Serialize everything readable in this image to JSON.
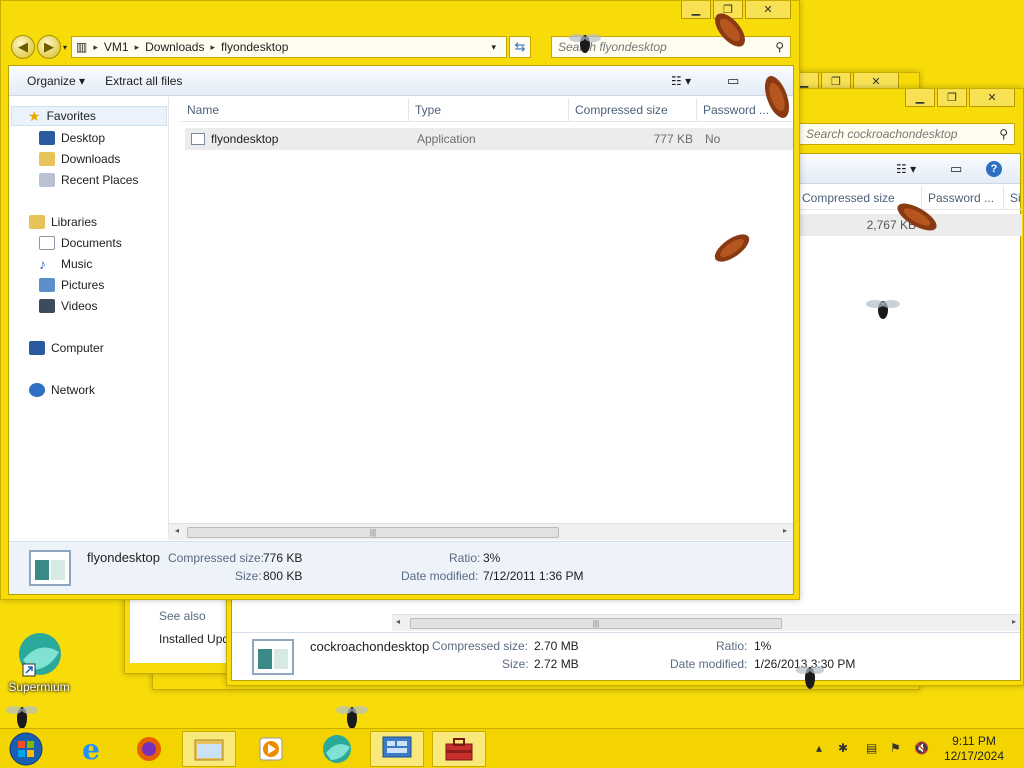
{
  "desktop": {
    "icon_label": "Supermium"
  },
  "back_window": {
    "search_placeholder": "Search cockroachondesktop",
    "columns": [
      "Compressed size",
      "Password ...",
      "Si"
    ],
    "row": {
      "size": "2,767 KB"
    },
    "side_labels": {
      "see_also": "See also",
      "installed": "Installed Upd"
    },
    "details": {
      "name": "cockroachondesktop",
      "compressed_label": "Compressed size:",
      "compressed_value": "2.70 MB",
      "size_label": "Size:",
      "size_value": "2.72 MB",
      "ratio_label": "Ratio:",
      "ratio_value": "1%",
      "modified_label": "Date modified:",
      "modified_value": "1/26/2013 3:30 PM"
    }
  },
  "front_window": {
    "breadcrumb": [
      "VM1",
      "Downloads",
      "flyondesktop"
    ],
    "search_placeholder": "Search flyondesktop",
    "toolbar": {
      "organize": "Organize ▾",
      "extract": "Extract all files"
    },
    "nav": {
      "favorites": "Favorites",
      "desktop": "Desktop",
      "downloads": "Downloads",
      "recent": "Recent Places",
      "libraries": "Libraries",
      "documents": "Documents",
      "music": "Music",
      "pictures": "Pictures",
      "videos": "Videos",
      "computer": "Computer",
      "network": "Network"
    },
    "columns": {
      "name": "Name",
      "type": "Type",
      "compressed": "Compressed size",
      "password": "Password ..."
    },
    "file": {
      "name": "flyondesktop",
      "type": "Application",
      "size": "777 KB",
      "password": "No"
    },
    "details": {
      "name": "flyondesktop",
      "compressed_label": "Compressed size:",
      "compressed_value": "776 KB",
      "size_label": "Size:",
      "size_value": "800 KB",
      "ratio_label": "Ratio:",
      "ratio_value": "3%",
      "modified_label": "Date modified:",
      "modified_value": "7/12/2011 1:36 PM"
    }
  },
  "taskbar": {
    "time": "9:11 PM",
    "date": "12/17/2024"
  },
  "colors": {
    "desktop": "#f7dc0a",
    "window_frame": "#f7dc0a"
  }
}
